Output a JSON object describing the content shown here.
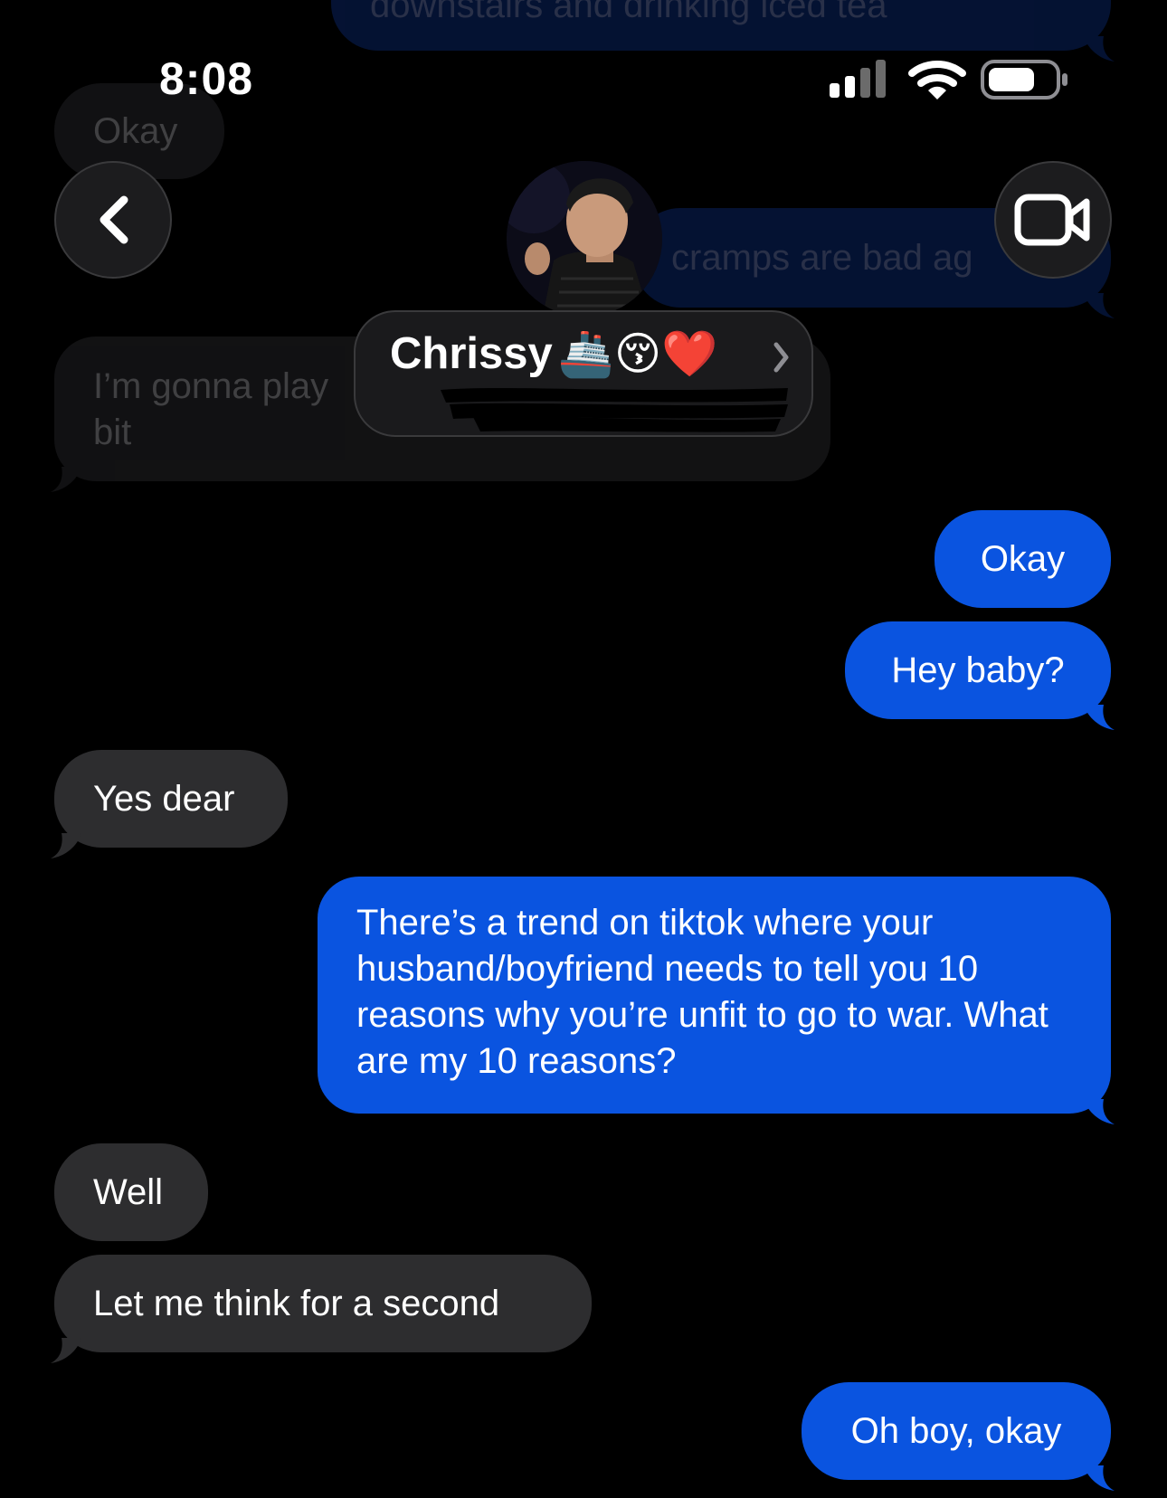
{
  "status_bar": {
    "time": "8:08"
  },
  "header": {
    "back_icon": "chevron-left-icon",
    "video_icon": "video-camera-icon",
    "contact_name": "Chrissy",
    "name_emoji": "🚢😚❤️"
  },
  "background_messages": {
    "top_outgoing": "downstairs and drinking iced tea",
    "okay_incoming": "Okay",
    "cramps_outgoing": "cramps are bad ag",
    "play_incoming_line1": "I’m gonna play",
    "play_incoming_line2": "bit"
  },
  "messages": [
    {
      "side": "out",
      "text": "Okay"
    },
    {
      "side": "out",
      "text": "Hey baby?"
    },
    {
      "side": "in",
      "text": "Yes dear"
    },
    {
      "side": "out",
      "text": "There’s a trend on tiktok where your husband/boyfriend needs to tell you 10 reasons why you’re unfit to go to war. What are my 10 reasons?"
    },
    {
      "side": "in",
      "text": "Well"
    },
    {
      "side": "in",
      "text": "Let me think for a second"
    },
    {
      "side": "out",
      "text": "Oh boy, okay"
    }
  ],
  "colors": {
    "background": "#000000",
    "incoming_bubble": "#2d2d2f",
    "outgoing_bubble": "#0a54e0"
  }
}
